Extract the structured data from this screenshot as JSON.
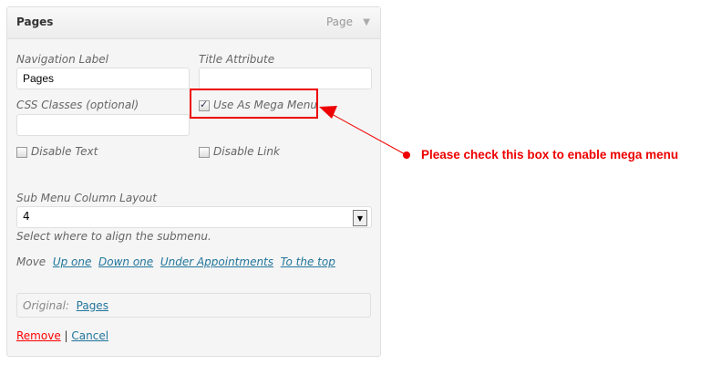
{
  "panel": {
    "title": "Pages",
    "type_label": "Page"
  },
  "fields": {
    "nav_label": {
      "label": "Navigation Label",
      "value": "Pages"
    },
    "title_attr": {
      "label": "Title Attribute",
      "value": ""
    },
    "css_classes": {
      "label": "CSS Classes (optional)",
      "value": ""
    },
    "mega_menu": {
      "label": "Use As Mega Menu",
      "checked": true
    },
    "disable_text": {
      "label": "Disable Text",
      "checked": false
    },
    "disable_link": {
      "label": "Disable Link",
      "checked": false
    },
    "column_layout": {
      "label": "Sub Menu Column Layout",
      "value": "4",
      "help": "Select where to align the submenu."
    }
  },
  "move": {
    "label": "Move",
    "links": [
      "Up one",
      "Down one",
      "Under Appointments",
      "To the top"
    ]
  },
  "original": {
    "label": "Original:",
    "link": "Pages"
  },
  "actions": {
    "remove": "Remove",
    "sep": "|",
    "cancel": "Cancel"
  },
  "annotation": {
    "text": "Please check this box to enable mega menu",
    "color": "#e00000"
  }
}
